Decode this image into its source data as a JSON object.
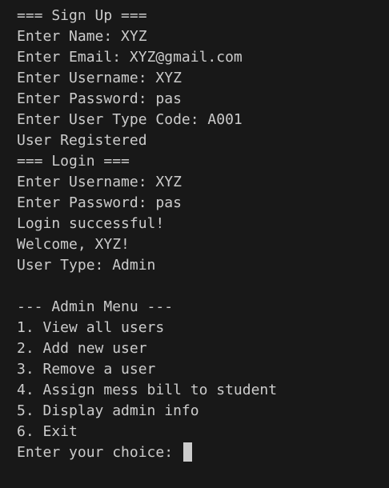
{
  "terminal": {
    "lines": [
      "=== Sign Up ===",
      "Enter Name: XYZ",
      "Enter Email: XYZ@gmail.com",
      "Enter Username: XYZ",
      "Enter Password: pas",
      "Enter User Type Code: A001",
      "User Registered",
      "=== Login ===",
      "Enter Username: XYZ",
      "Enter Password: pas",
      "Login successful!",
      "Welcome, XYZ!",
      "User Type: Admin",
      "",
      "--- Admin Menu ---",
      "1. View all users",
      "2. Add new user",
      "3. Remove a user",
      "4. Assign mess bill to student",
      "5. Display admin info",
      "6. Exit"
    ],
    "prompt": "Enter your choice: "
  },
  "colors": {
    "background": "#181818",
    "text": "#cccccc"
  }
}
